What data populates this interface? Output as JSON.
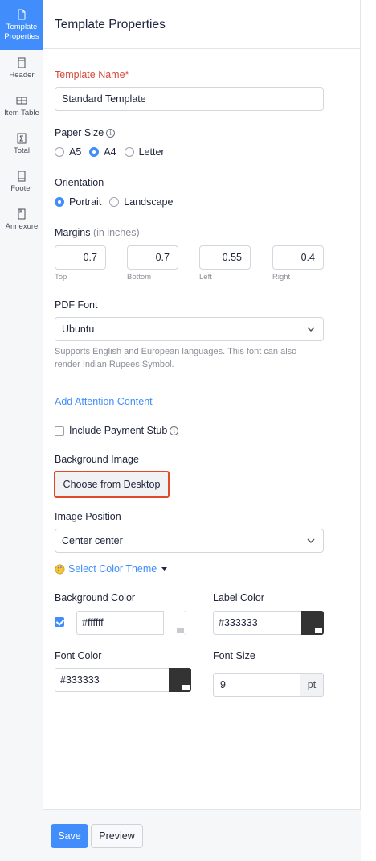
{
  "rail": {
    "items": [
      {
        "label1": "Template",
        "label2": "Properties",
        "icon": "document-icon"
      },
      {
        "label": "Header",
        "icon": "header-icon"
      },
      {
        "label": "Item Table",
        "icon": "table-icon"
      },
      {
        "label": "Total",
        "icon": "sigma-icon"
      },
      {
        "label": "Footer",
        "icon": "footer-icon"
      },
      {
        "label": "Annexure",
        "icon": "annexure-icon"
      }
    ]
  },
  "panel": {
    "title": "Template Properties",
    "template_name": {
      "label": "Template Name*",
      "value": "Standard Template"
    },
    "paper_size": {
      "label": "Paper Size",
      "options": [
        "A5",
        "A4",
        "Letter"
      ],
      "selected": "A4"
    },
    "orientation": {
      "label": "Orientation",
      "options": [
        "Portrait",
        "Landscape"
      ],
      "selected": "Portrait"
    },
    "margins": {
      "label": "Margins",
      "unit": "(in inches)",
      "fields": [
        {
          "caption": "Top",
          "value": "0.7"
        },
        {
          "caption": "Bottom",
          "value": "0.7"
        },
        {
          "caption": "Left",
          "value": "0.55"
        },
        {
          "caption": "Right",
          "value": "0.4"
        }
      ]
    },
    "pdf_font": {
      "label": "PDF Font",
      "value": "Ubuntu",
      "help_line1": "Supports English and European languages. This font can also",
      "help_line2": "render Indian Rupees Symbol."
    },
    "add_attention_label": "Add Attention Content",
    "include_payment_stub": {
      "label": "Include Payment Stub",
      "checked": false
    },
    "background_image": {
      "label": "Background Image",
      "button_label": "Choose from Desktop"
    },
    "image_position": {
      "label": "Image Position",
      "value": "Center center"
    },
    "color_theme_label": "Select Color Theme",
    "background_color": {
      "label": "Background Color",
      "value": "#ffffff",
      "checked": true,
      "swatch": "#ffffff"
    },
    "label_color": {
      "label": "Label Color",
      "value": "#333333",
      "swatch": "#333333"
    },
    "font_color": {
      "label": "Font Color",
      "value": "#333333",
      "swatch": "#333333"
    },
    "font_size": {
      "label": "Font Size",
      "value": "9",
      "unit": "pt"
    }
  },
  "footer": {
    "save_label": "Save",
    "preview_label": "Preview"
  },
  "colors": {
    "accent": "#408dfb",
    "required": "#d6493c",
    "highlight_border": "#e04a2b"
  }
}
